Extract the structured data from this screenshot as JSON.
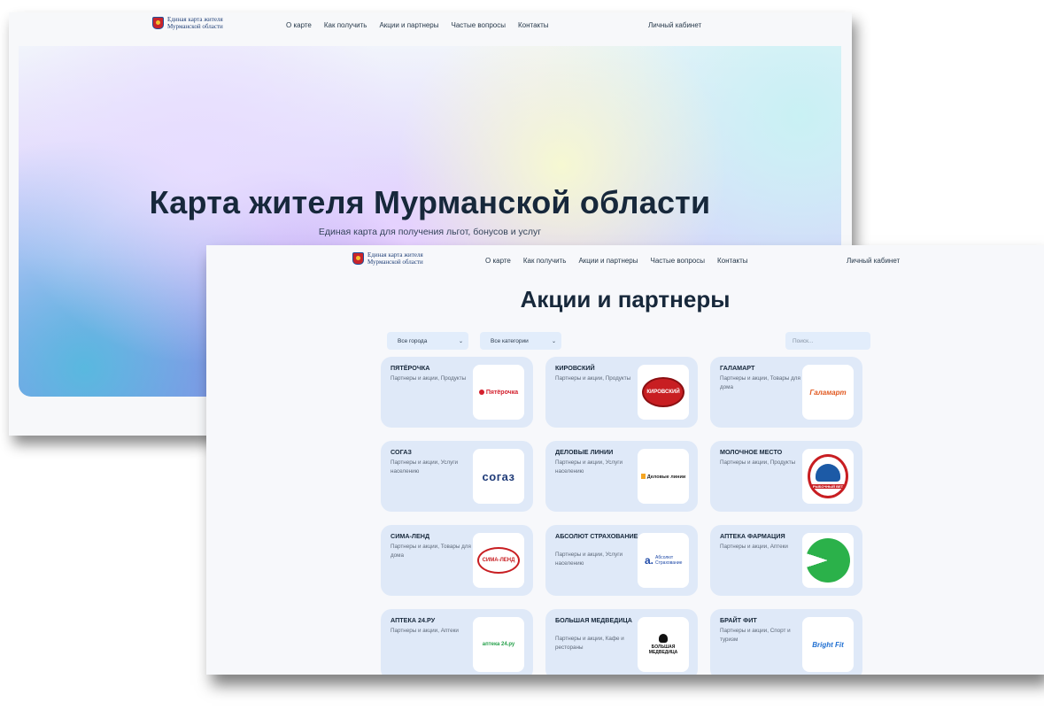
{
  "header": {
    "logo_text": "Единая карта жителя\nМурманской области",
    "nav": [
      "О карте",
      "Как получить",
      "Акции и партнеры",
      "Частые вопросы",
      "Контакты"
    ],
    "cabinet": "Личный кабинет"
  },
  "hero": {
    "title": "Карта жителя Мурманской области",
    "subtitle": "Единая карта для получения льгот, бонусов и услуг"
  },
  "partners_page": {
    "title": "Акции и партнеры",
    "filters": {
      "city": "Все города",
      "category": "Все категории",
      "search_placeholder": "Поиск..."
    },
    "cards": [
      {
        "name": "ПЯТЁРОЧКА",
        "desc": "Партнеры и акции, Продукты",
        "logo": "Пятёрочка"
      },
      {
        "name": "КИРОВСКИЙ",
        "desc": "Партнеры и акции, Продукты",
        "logo": "КИРОВСКИЙ"
      },
      {
        "name": "ГАЛАМАРТ",
        "desc": "Партнеры и акции, Товары для дома",
        "logo": "Галамарт"
      },
      {
        "name": "СОГАЗ",
        "desc": "Партнеры и акции, Услуги населению",
        "logo": "согаз"
      },
      {
        "name": "ДЕЛОВЫЕ ЛИНИИ",
        "desc": "Партнеры и акции, Услуги населению",
        "logo": "Деловые линии"
      },
      {
        "name": "МОЛОЧНОЕ МЕСТО",
        "desc": "Партнеры и акции, Продукты",
        "logo": "РЫБОЧНЫЙ ВЕТ"
      },
      {
        "name": "СИМА-ЛЕНД",
        "desc": "Партнеры и акции, Товары для дома",
        "logo": "СИМА-ЛЕНД"
      },
      {
        "name": "АБСОЛЮТ СТРАХОВАНИЕ",
        "desc": "Партнеры и акции, Услуги населению",
        "logo": "Абсолют Страхование"
      },
      {
        "name": "АПТЕКА ФАРМАЦИЯ",
        "desc": "Партнеры и акции, Аптеки",
        "logo": ""
      },
      {
        "name": "АПТЕКА 24.РУ",
        "desc": "Партнеры и акции, Аптеки",
        "logo": "аптека 24.ру"
      },
      {
        "name": "БОЛЬШАЯ МЕДВЕДИЦА",
        "desc": "Партнеры и акции, Кафе и рестораны",
        "logo": "БОЛЬШАЯ\nМЕДВЕДИЦА"
      },
      {
        "name": "БРАЙТ ФИТ",
        "desc": "Партнеры и акции, Спорт и туризм",
        "logo": "Bright Fit"
      }
    ]
  }
}
